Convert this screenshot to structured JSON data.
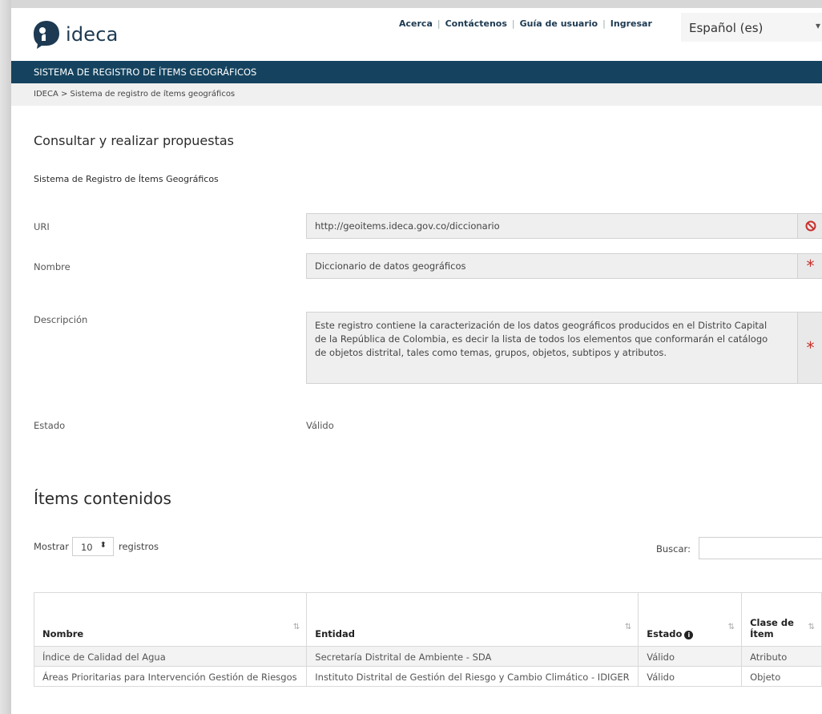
{
  "header": {
    "logo_text": "ideca",
    "links": [
      "Acerca",
      "Contáctenos",
      "Guía de usuario",
      "Ingresar"
    ],
    "language": "Español (es)"
  },
  "banner": {
    "title": "SISTEMA DE REGISTRO DE ÍTEMS GEOGRÁFICOS"
  },
  "breadcrumb": {
    "text": "IDECA > Sistema de registro de ítems geográficos"
  },
  "page": {
    "heading": "Consultar y realizar propuestas",
    "subheading": "Sistema de Registro de Ítems Geográficos"
  },
  "form": {
    "uri_label": "URI",
    "uri_value": "http://geoitems.ideca.gov.co/diccionario",
    "nombre_label": "Nombre",
    "nombre_value": "Diccionario de datos geográficos",
    "descripcion_label": "Descripción",
    "descripcion_value": "Este registro contiene la caracterización de los datos geográficos producidos en el Distrito Capital de la República de Colombia, es decir la lista de todos los elementos que conformarán el catálogo de objetos distrital, tales como temas, grupos, objetos, subtipos y atributos.",
    "estado_label": "Estado",
    "estado_value": "Válido"
  },
  "items": {
    "heading": "Ítems contenidos",
    "show_label": "Mostrar",
    "show_value": "10",
    "records_label": "registros",
    "search_label": "Buscar:",
    "columns": [
      "Nombre",
      "Entidad",
      "Estado",
      "Clase de Ítem"
    ],
    "rows": [
      [
        "Índice de Calidad del Agua",
        "Secretaría Distrital de Ambiente - SDA",
        "Válido",
        "Atributo"
      ],
      [
        "Áreas Prioritarias para Intervención Gestión de Riesgos",
        "Instituto Distrital de Gestión del Riesgo y Cambio Climático - IDIGER",
        "Válido",
        "Objeto"
      ]
    ]
  }
}
